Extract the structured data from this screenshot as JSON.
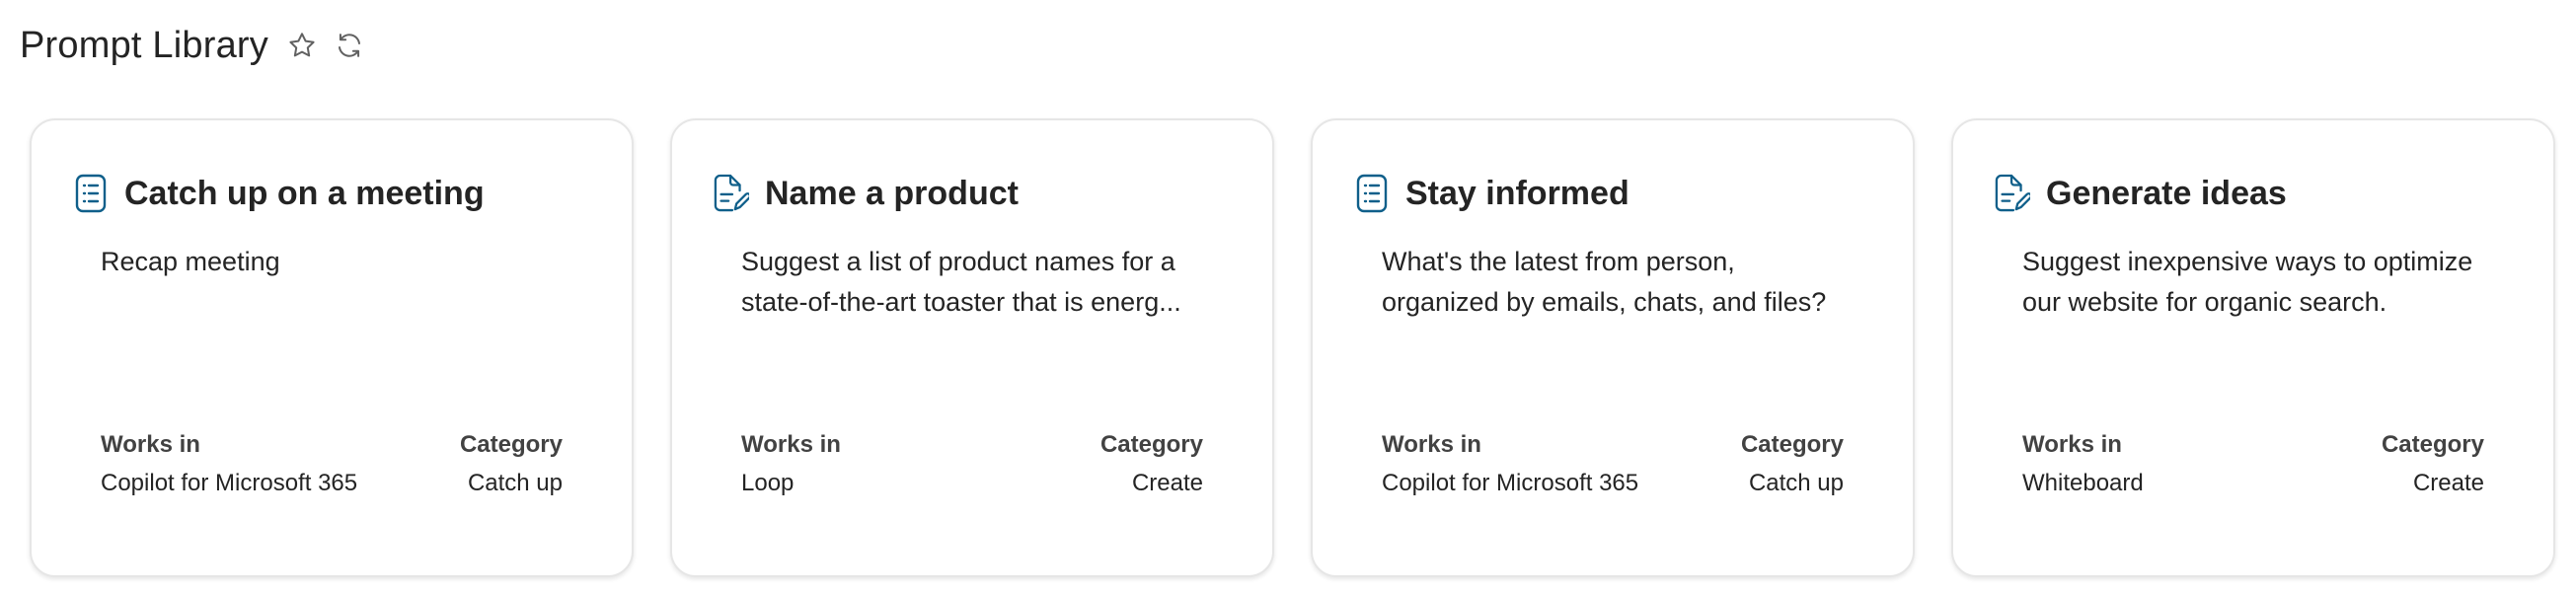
{
  "header": {
    "title": "Prompt Library",
    "icons": [
      "star-icon",
      "refresh-icon"
    ]
  },
  "colors": {
    "icon_accent": "#0f5f8a",
    "text": "#242424",
    "card_border": "#e6e6e6"
  },
  "cards": [
    {
      "icon": "list-icon",
      "title": "Catch up on a meeting",
      "description": "Recap meeting",
      "works_in_label": "Works in",
      "works_in": "Copilot for Microsoft 365",
      "category_label": "Category",
      "category": "Catch up"
    },
    {
      "icon": "edit-document-icon",
      "title": "Name a product",
      "description": "Suggest a list of product names for a state-of-the-art toaster that is energ...",
      "works_in_label": "Works in",
      "works_in": "Loop",
      "category_label": "Category",
      "category": "Create"
    },
    {
      "icon": "list-icon",
      "title": "Stay informed",
      "description": "What's the latest from person, organized by emails, chats, and files?",
      "works_in_label": "Works in",
      "works_in": "Copilot for Microsoft 365",
      "category_label": "Category",
      "category": "Catch up"
    },
    {
      "icon": "edit-document-icon",
      "title": "Generate ideas",
      "description": "Suggest inexpensive ways to optimize our website for organic search.",
      "works_in_label": "Works in",
      "works_in": "Whiteboard",
      "category_label": "Category",
      "category": "Create"
    }
  ]
}
